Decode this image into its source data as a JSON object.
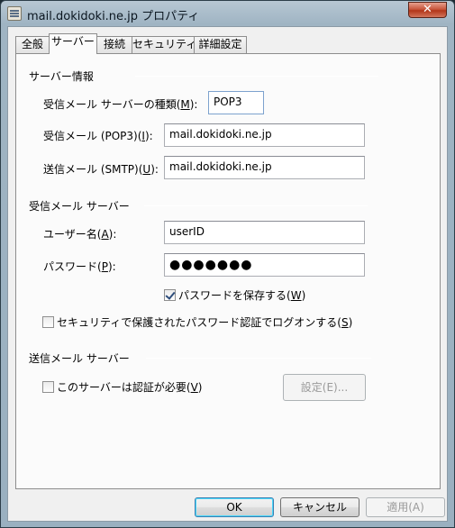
{
  "window": {
    "title": "mail.dokidoki.ne.jp プロパティ",
    "close_glyph": "✕"
  },
  "tabs": [
    {
      "label": "全般"
    },
    {
      "label": "サーバー"
    },
    {
      "label": "接続"
    },
    {
      "label": "セキュリティ"
    },
    {
      "label": "詳細設定"
    }
  ],
  "server_info": {
    "title": "サーバー情報",
    "type_label": "受信メール サーバーの種類(",
    "type_key": "M",
    "type_value": "POP3",
    "pop3_label": "受信メール (POP3)(",
    "pop3_key": "I",
    "pop3_value": "mail.dokidoki.ne.jp",
    "smtp_label": "送信メール (SMTP)(",
    "smtp_key": "U",
    "smtp_value": "mail.dokidoki.ne.jp"
  },
  "incoming": {
    "title": "受信メール サーバー",
    "user_label": "ユーザー名(",
    "user_key": "A",
    "user_value": "userID",
    "password_label": "パスワード(",
    "password_key": "P",
    "password_value": "●●●●●●●",
    "save_password_label": "パスワードを保存する(",
    "save_password_key": "W",
    "save_password_checked": true,
    "spa_label": "セキュリティで保護されたパスワード認証でログオンする(",
    "spa_key": "S",
    "spa_checked": false
  },
  "outgoing": {
    "title": "送信メール サーバー",
    "auth_label": "このサーバーは認証が必要(",
    "auth_key": "V",
    "auth_checked": false,
    "settings_button": "設定(E)..."
  },
  "buttons": {
    "ok": "OK",
    "cancel": "キャンセル",
    "apply": "適用(A)"
  }
}
